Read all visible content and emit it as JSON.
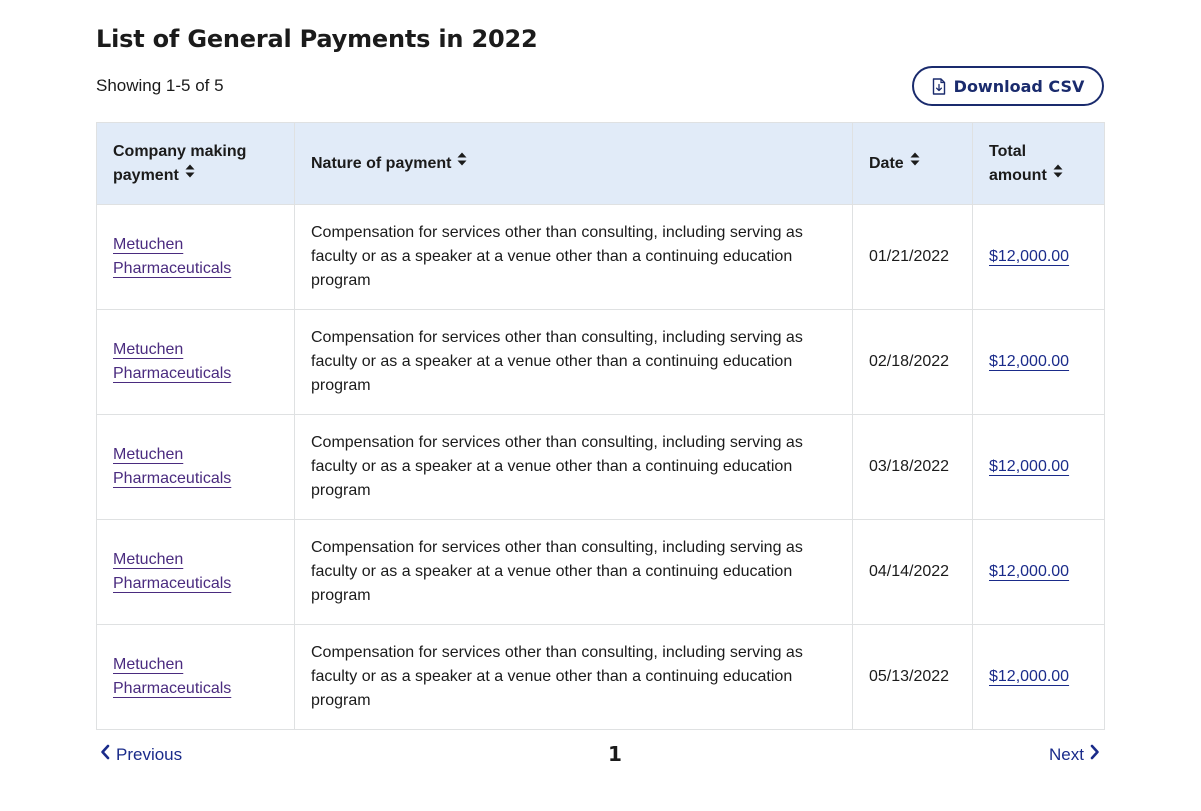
{
  "page": {
    "title": "List of General Payments in 2022",
    "showing": "Showing 1-5 of 5",
    "download_label": "Download CSV",
    "accent_color": "#1a2b6d",
    "header_bg": "#e1ebf8"
  },
  "table": {
    "columns": [
      {
        "line1": "Company making",
        "line2": "payment"
      },
      {
        "line1": "Nature of payment",
        "line2": ""
      },
      {
        "line1": "Date",
        "line2": ""
      },
      {
        "line1": "Total",
        "line2": "amount"
      }
    ],
    "rows": [
      {
        "company_line1": "Metuchen",
        "company_line2": "Pharmaceuticals",
        "nature": "Compensation for services other than consulting, including serving as faculty or as a speaker at a venue other than a continuing education program",
        "date": "01/21/2022",
        "amount": "$12,000.00"
      },
      {
        "company_line1": "Metuchen",
        "company_line2": "Pharmaceuticals",
        "nature": "Compensation for services other than consulting, including serving as faculty or as a speaker at a venue other than a continuing education program",
        "date": "02/18/2022",
        "amount": "$12,000.00"
      },
      {
        "company_line1": "Metuchen",
        "company_line2": "Pharmaceuticals",
        "nature": "Compensation for services other than consulting, including serving as faculty or as a speaker at a venue other than a continuing education program",
        "date": "03/18/2022",
        "amount": "$12,000.00"
      },
      {
        "company_line1": "Metuchen",
        "company_line2": "Pharmaceuticals",
        "nature": "Compensation for services other than consulting, including serving as faculty or as a speaker at a venue other than a continuing education program",
        "date": "04/14/2022",
        "amount": "$12,000.00"
      },
      {
        "company_line1": "Metuchen",
        "company_line2": "Pharmaceuticals",
        "nature": "Compensation for services other than consulting, including serving as faculty or as a speaker at a venue other than a continuing education program",
        "date": "05/13/2022",
        "amount": "$12,000.00"
      }
    ]
  },
  "pagination": {
    "previous_label": "Previous",
    "current_page": "1",
    "next_label": "Next"
  }
}
